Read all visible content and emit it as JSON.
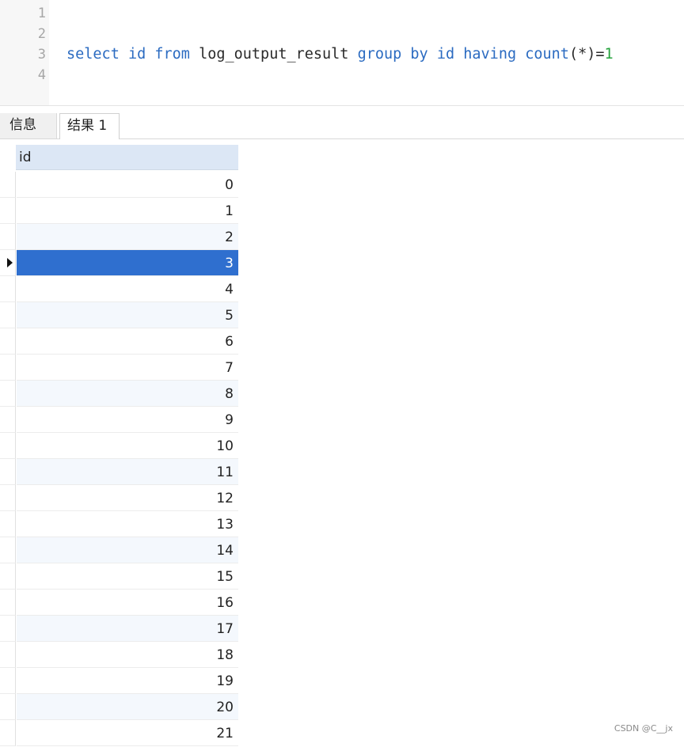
{
  "editor": {
    "line_numbers": [
      "1",
      "2",
      "3",
      "4"
    ],
    "query_tokens": [
      {
        "text": "select",
        "kind": "kw"
      },
      {
        "text": " ",
        "kind": "id"
      },
      {
        "text": "id",
        "kind": "kw"
      },
      {
        "text": " ",
        "kind": "id"
      },
      {
        "text": "from",
        "kind": "kw"
      },
      {
        "text": " log_output_result ",
        "kind": "id"
      },
      {
        "text": "group",
        "kind": "kw"
      },
      {
        "text": " ",
        "kind": "id"
      },
      {
        "text": "by",
        "kind": "kw"
      },
      {
        "text": " ",
        "kind": "id"
      },
      {
        "text": "id",
        "kind": "kw"
      },
      {
        "text": " ",
        "kind": "id"
      },
      {
        "text": "having",
        "kind": "kw"
      },
      {
        "text": " ",
        "kind": "id"
      },
      {
        "text": "count",
        "kind": "kw"
      },
      {
        "text": "(*)=",
        "kind": "id"
      },
      {
        "text": "1",
        "kind": "num"
      }
    ],
    "query_line": 3
  },
  "tabs": {
    "info_label": "信息",
    "result_label": "结果 1",
    "active": "result"
  },
  "grid": {
    "column_header": "id",
    "rows": [
      "0",
      "1",
      "2",
      "3",
      "4",
      "5",
      "6",
      "7",
      "8",
      "9",
      "10",
      "11",
      "12",
      "13",
      "14",
      "15",
      "16",
      "17",
      "18",
      "19",
      "20",
      "21"
    ],
    "selected_index": 3,
    "alt_rows": [
      2,
      5,
      8,
      11,
      14,
      17,
      20
    ]
  },
  "watermark": "CSDN @C__jx",
  "colors": {
    "keyword": "#2b6bc1",
    "number": "#26a33d",
    "selection": "#2f6fcf",
    "header_bg": "#dce7f5"
  }
}
